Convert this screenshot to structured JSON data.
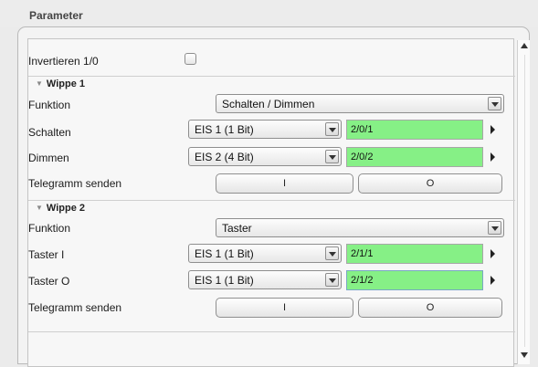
{
  "header": {
    "title": "Parameter"
  },
  "invert": {
    "label": "Invertieren 1/0",
    "checked": false
  },
  "wippe1": {
    "title": "Wippe 1",
    "funktion": {
      "label": "Funktion",
      "value": "Schalten / Dimmen"
    },
    "schalten": {
      "label": "Schalten",
      "eis": "EIS 1 (1 Bit)",
      "address": "2/0/1"
    },
    "dimmen": {
      "label": "Dimmen",
      "eis": "EIS 2 (4 Bit)",
      "address": "2/0/2"
    },
    "telegramm": {
      "label": "Telegramm senden",
      "btn_i": "I",
      "btn_o": "O"
    }
  },
  "wippe2": {
    "title": "Wippe 2",
    "funktion": {
      "label": "Funktion",
      "value": "Taster"
    },
    "taster_i": {
      "label": "Taster I",
      "eis": "EIS 1 (1 Bit)",
      "address": "2/1/1"
    },
    "taster_o": {
      "label": "Taster O",
      "eis": "EIS 1 (1 Bit)",
      "address": "2/1/2"
    },
    "telegramm": {
      "label": "Telegramm senden",
      "btn_i": "I",
      "btn_o": "O"
    }
  },
  "colors": {
    "address_bg": "#86f086",
    "panel_bg": "#f7f7f7"
  },
  "icons": {
    "section_toggle": "triangle-down-icon",
    "dropdown": "chevron-down-icon",
    "address_menu": "triangle-right-icon"
  }
}
